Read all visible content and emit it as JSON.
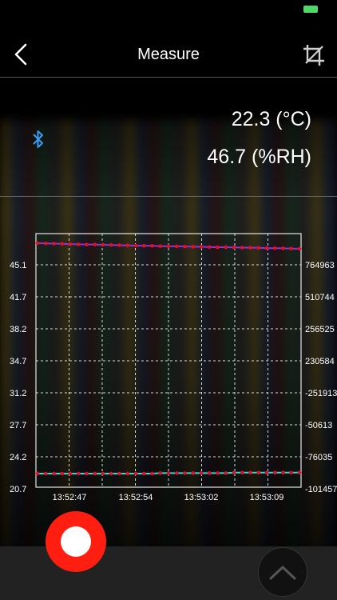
{
  "header": {
    "title": "Measure"
  },
  "icons": {
    "back": "chevron-left-icon",
    "crop": "crop-icon",
    "bluetooth": "bluetooth-icon",
    "expand": "chevron-up-icon"
  },
  "readings": {
    "temperature": "22.3 (°C)",
    "humidity": "46.7 (%RH)"
  },
  "colors": {
    "battery": "#4cd964",
    "record": "#ff1e10",
    "bluetooth": "#3a9cf0",
    "temp_line": "#9b2fd6",
    "hum_line": "#35d6d6",
    "points": "#e0102a"
  },
  "chart_data": {
    "type": "line",
    "left_ticks": [
      "45.1",
      "41.7",
      "38.2",
      "34.7",
      "31.2",
      "27.7",
      "24.2",
      "20.7"
    ],
    "right_ticks": [
      "764963",
      "510744",
      "256525",
      "230584",
      "-251913",
      "-50613",
      "-76035",
      "-101457"
    ],
    "x_ticks": [
      "13:52:47",
      "13:52:54",
      "13:53:02",
      "13:53:09"
    ],
    "ylim": [
      20.7,
      48.6
    ],
    "grid": true,
    "series": [
      {
        "values": [
          47.55,
          47.52,
          47.5,
          47.47,
          47.45,
          47.42,
          47.4,
          47.4,
          47.37,
          47.35,
          47.32,
          47.3,
          47.28,
          47.26,
          47.25,
          47.22,
          47.2,
          47.2,
          47.18,
          47.16,
          47.15,
          47.13,
          47.1,
          47.1,
          47.08,
          47.06,
          47.05,
          47.03,
          47.0,
          47.0,
          46.98,
          46.95,
          46.93
        ]
      },
      {
        "values": [
          22.2,
          22.2,
          22.2,
          22.2,
          22.2,
          22.2,
          22.2,
          22.2,
          22.2,
          22.2,
          22.2,
          22.2,
          22.2,
          22.2,
          22.2,
          22.25,
          22.25,
          22.25,
          22.25,
          22.25,
          22.25,
          22.25,
          22.25,
          22.25,
          22.3,
          22.3,
          22.3,
          22.3,
          22.3,
          22.3,
          22.3,
          22.3,
          22.3
        ]
      }
    ]
  }
}
